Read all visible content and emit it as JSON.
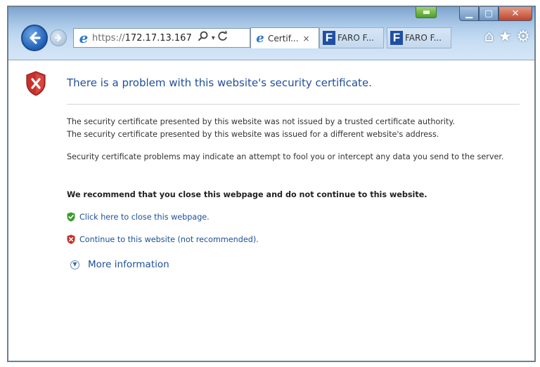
{
  "window": {
    "minimize_icon": "minimize-icon",
    "maximize_icon": "maximize-icon",
    "close_icon": "close-icon"
  },
  "toolbar": {
    "back_icon": "back-arrow-icon",
    "forward_icon": "forward-arrow-icon",
    "address": {
      "protocol": "https://",
      "host": "172.17.13.167",
      "search_icon": "search-icon",
      "dropdown_icon": "chevron-down-icon",
      "refresh_icon": "refresh-icon"
    },
    "tabs": [
      {
        "label": "Certif...",
        "favicon": "ie-icon",
        "active": true,
        "close": "×"
      },
      {
        "label": "FARO F...",
        "favicon": "faro-icon",
        "active": false
      },
      {
        "label": "FARO F...",
        "favicon": "faro-icon",
        "active": false
      }
    ],
    "home_icon": "home-icon",
    "favorites_icon": "star-icon",
    "settings_icon": "gear-icon"
  },
  "page": {
    "title": "There is a problem with this website's security certificate.",
    "lines": [
      "The security certificate presented by this website was not issued by a trusted certificate authority.",
      "The security certificate presented by this website was issued for a different website's address."
    ],
    "warning": "Security certificate problems may indicate an attempt to fool you or intercept any data you send to the server.",
    "recommendation": "We recommend that you close this webpage and do not continue to this website.",
    "close_link": "Click here to close this webpage.",
    "continue_link": "Continue to this website (not recommended).",
    "more_info": "More information"
  },
  "colors": {
    "link": "#1f4f99",
    "title": "#1f4f99",
    "shield": "#c9302c",
    "safe": "#3b9b2f"
  }
}
